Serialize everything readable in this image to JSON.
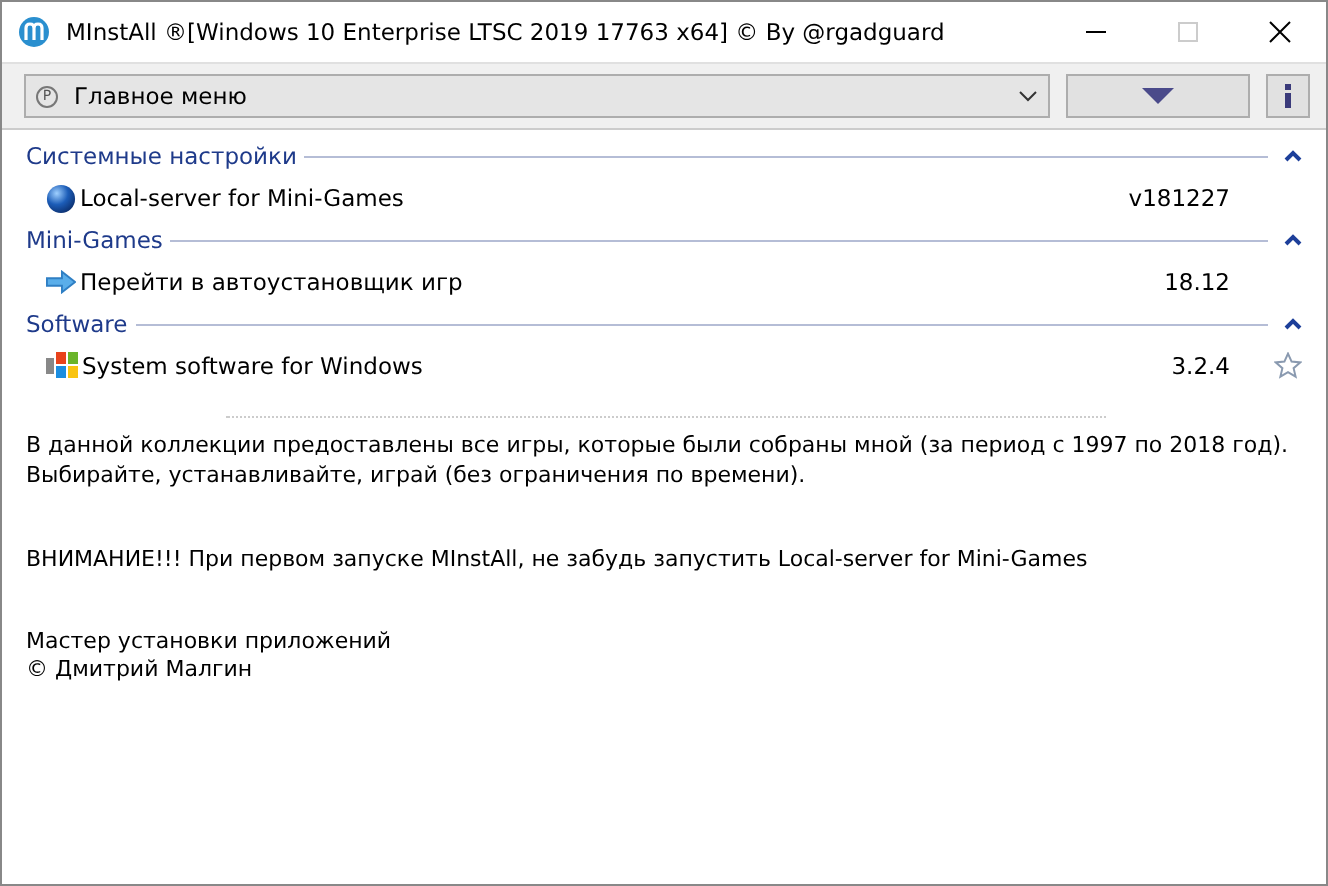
{
  "window": {
    "title": "MInstAll ®[Windows 10 Enterprise LTSC 2019 17763 x64] © By @rgadguard"
  },
  "toolbar": {
    "menu": {
      "icon_letter": "P",
      "value": "Главное меню"
    }
  },
  "groups": [
    {
      "title": "Системные настройки",
      "expanded": true,
      "items": [
        {
          "kind": "globe",
          "name": "Local-server for Mini-Games",
          "version": "v181227"
        }
      ]
    },
    {
      "title": "Mini-Games",
      "expanded": true,
      "items": [
        {
          "kind": "arrow",
          "name": "Перейти в автоустановщик игр",
          "version": "18.12"
        }
      ]
    },
    {
      "title": "Software",
      "expanded": true,
      "items": [
        {
          "kind": "windows",
          "name": "System software for Windows",
          "version": "3.2.4",
          "starred": false
        }
      ]
    }
  ],
  "description": [
    "В данной коллекции предоставлены все игры, которые были собраны мной (за период с 1997 по 2018 год). Выбирайте, устанавливайте, играй (без ограничения по времени).",
    "ВНИМАНИЕ!!! При первом запуске MInstAll, не забудь запустить Local-server for Mini-Games"
  ],
  "footer": [
    "Мастер установки приложений",
    "© Дмитрий Малгин"
  ]
}
